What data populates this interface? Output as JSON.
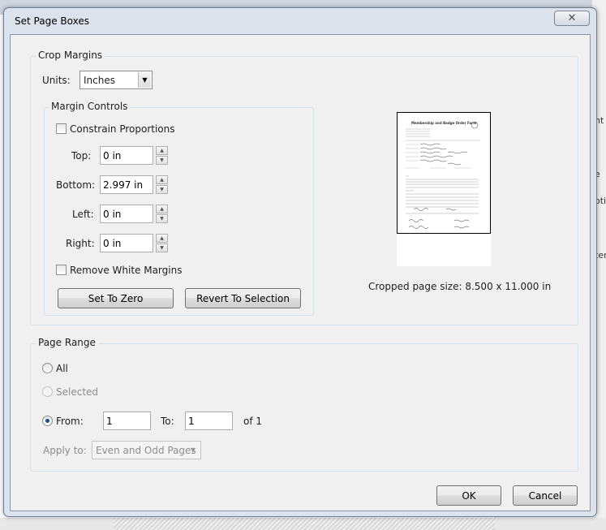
{
  "background": {
    "right_panel_fragments": [
      "nt",
      "e",
      "oti",
      "ter"
    ]
  },
  "dialog": {
    "title": "Set Page Boxes",
    "close_glyph": "✕"
  },
  "crop_margins": {
    "group_label": "Crop Margins",
    "units_label": "Units:",
    "units_value": "Inches",
    "margin_controls": {
      "group_label": "Margin Controls",
      "constrain_label": "Constrain Proportions",
      "constrain_checked": false,
      "top_label": "Top:",
      "top_value": "0 in",
      "bottom_label": "Bottom:",
      "bottom_value": "2.997 in",
      "left_label": "Left:",
      "left_value": "0 in",
      "right_label": "Right:",
      "right_value": "0 in",
      "remove_white_label": "Remove White Margins",
      "remove_white_checked": false,
      "set_to_zero_label": "Set To Zero",
      "revert_label": "Revert To Selection"
    },
    "preview": {
      "form_title": "Membership and Badge Order Form",
      "cropped_size_text": "Cropped page size: 8.500 x 11.000 in"
    }
  },
  "page_range": {
    "group_label": "Page Range",
    "all_label": "All",
    "selected_label": "Selected",
    "from_label": "From:",
    "from_value": "1",
    "to_label": "To:",
    "to_value": "1",
    "of_text": "of 1",
    "selected_option": "from",
    "apply_to_label": "Apply to:",
    "apply_to_value": "Even and Odd Pages"
  },
  "buttons": {
    "ok_label": "OK",
    "cancel_label": "Cancel"
  },
  "colors": {
    "dialog_frame": "#dde3ec",
    "client_bg": "#f0f0f0",
    "group_border": "#d5dfe5",
    "radio_dot": "#1f4f8a"
  }
}
